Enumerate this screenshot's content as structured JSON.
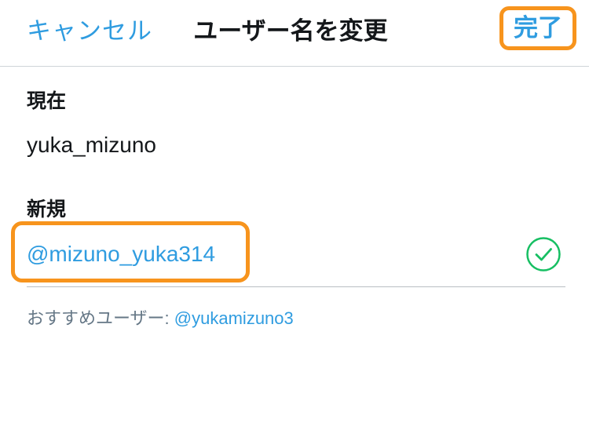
{
  "nav": {
    "cancel_label": "キャンセル",
    "title": "ユーザー名を変更",
    "done_label": "完了"
  },
  "current": {
    "label": "現在",
    "value": "yuka_mizuno"
  },
  "new": {
    "label": "新規",
    "value": "@mizuno_yuka314",
    "status_icon": "check-circle-icon"
  },
  "suggestion": {
    "prefix": "おすすめユーザー: ",
    "username": "@yukamizuno3"
  },
  "colors": {
    "accent": "#2f9ce0",
    "highlight": "#f7941d",
    "success": "#17bf63"
  }
}
